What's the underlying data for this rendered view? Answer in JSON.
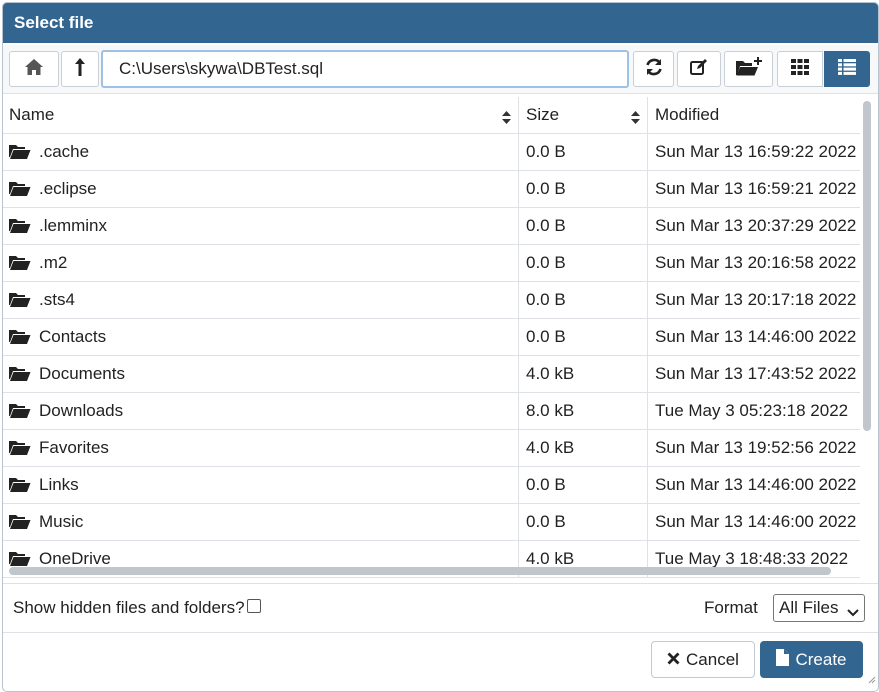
{
  "dialog": {
    "title": "Select file"
  },
  "toolbar": {
    "path_value": "C:\\Users\\skywa\\DBTest.sql",
    "home_icon": "home-icon",
    "up_icon": "level-up-icon",
    "refresh_icon": "refresh-icon",
    "rename_icon": "edit-icon",
    "new_folder_icon": "folder-plus-icon",
    "grid_view_icon": "grid-icon",
    "list_view_icon": "list-icon",
    "active_view": "list"
  },
  "table": {
    "columns": [
      "Name",
      "Size",
      "Modified"
    ],
    "rows": [
      {
        "name": ".cache",
        "size": "0.0 B",
        "modified": "Sun Mar 13 16:59:22 2022"
      },
      {
        "name": ".eclipse",
        "size": "0.0 B",
        "modified": "Sun Mar 13 16:59:21 2022"
      },
      {
        "name": ".lemminx",
        "size": "0.0 B",
        "modified": "Sun Mar 13 20:37:29 2022"
      },
      {
        "name": ".m2",
        "size": "0.0 B",
        "modified": "Sun Mar 13 20:16:58 2022"
      },
      {
        "name": ".sts4",
        "size": "0.0 B",
        "modified": "Sun Mar 13 20:17:18 2022"
      },
      {
        "name": "Contacts",
        "size": "0.0 B",
        "modified": "Sun Mar 13 14:46:00 2022"
      },
      {
        "name": "Documents",
        "size": "4.0 kB",
        "modified": "Sun Mar 13 17:43:52 2022"
      },
      {
        "name": "Downloads",
        "size": "8.0 kB",
        "modified": "Tue May 3 05:23:18 2022"
      },
      {
        "name": "Favorites",
        "size": "4.0 kB",
        "modified": "Sun Mar 13 19:52:56 2022"
      },
      {
        "name": "Links",
        "size": "0.0 B",
        "modified": "Sun Mar 13 14:46:00 2022"
      },
      {
        "name": "Music",
        "size": "0.0 B",
        "modified": "Sun Mar 13 14:46:00 2022"
      },
      {
        "name": "OneDrive",
        "size": "4.0 kB",
        "modified": "Tue May 3 18:48:33 2022"
      }
    ]
  },
  "footer": {
    "show_hidden_label": "Show hidden files and folders?",
    "show_hidden_checked": false,
    "format_label": "Format",
    "format_value": "All Files",
    "cancel_label": "Cancel",
    "create_label": "Create"
  },
  "colors": {
    "primary": "#326690",
    "border": "#dee2e6",
    "scrollbar": "#c1c6cc"
  }
}
